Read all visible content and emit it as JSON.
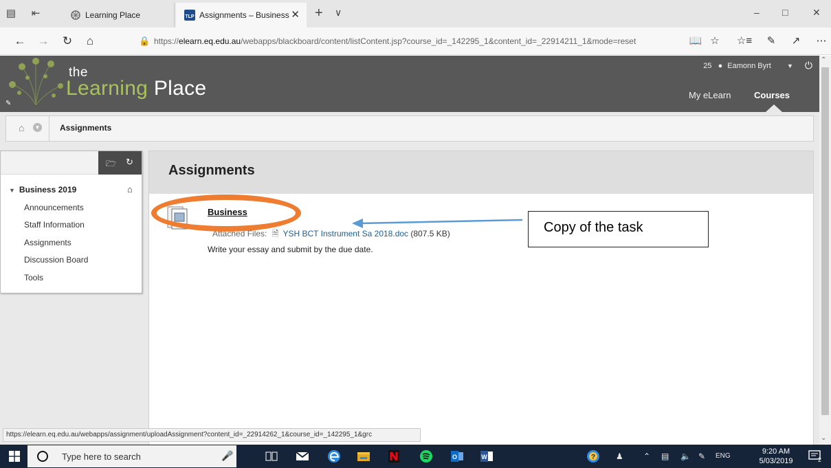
{
  "browser": {
    "tabs": [
      {
        "title": "Learning Place",
        "active": false
      },
      {
        "title": "Assignments – Business",
        "active": true
      }
    ],
    "new_tab_symbol": "+",
    "tab_list_symbol": "∨",
    "close_symbol": "✕",
    "address": {
      "prefix": "https://",
      "host": "elearn.eq.edu.au",
      "path": "/webapps/blackboard/content/listContent.jsp?course_id=_142295_1&content_id=_22914211_1&mode=reset"
    },
    "window_controls": [
      "–",
      "□",
      "✕"
    ],
    "more_symbol": "⋯"
  },
  "site": {
    "logo_small": "the",
    "logo_word_1": "Learning",
    "logo_word_2": "Place",
    "user_count": "25",
    "user_name": "Eamonn Byrt",
    "nav": {
      "my_elearn": "My eLearn",
      "courses": "Courses"
    },
    "brand_colors": {
      "header": "#585858",
      "logo_accent": "#a9c25a",
      "link": "#1d5f93"
    }
  },
  "breadcrumb": {
    "current": "Assignments"
  },
  "course_menu": {
    "course_name": "Business 2019",
    "items": [
      "Announcements",
      "Staff Information",
      "Assignments",
      "Discussion Board",
      "Tools"
    ]
  },
  "content": {
    "page_title": "Assignments",
    "item": {
      "title": "Business",
      "attached_label": "Attached Files:",
      "file_name": "YSH BCT Instrument Sa 2018.doc",
      "file_size": "(807.5 KB)",
      "description": "Write your essay and submit by the due date."
    }
  },
  "annotation": {
    "callout_text": "Copy of the task",
    "ellipse_color": "#ee7d31",
    "arrow_color": "#5b9bd5"
  },
  "status_bar": {
    "url": "https://elearn.eq.edu.au/webapps/assignment/uploadAssignment?content_id=_22914262_1&course_id=_142295_1&grc"
  },
  "taskbar": {
    "search_placeholder": "Type here to search",
    "language": "ENG",
    "time": "9:20 AM",
    "date": "5/03/2019",
    "notification_count": "2"
  }
}
